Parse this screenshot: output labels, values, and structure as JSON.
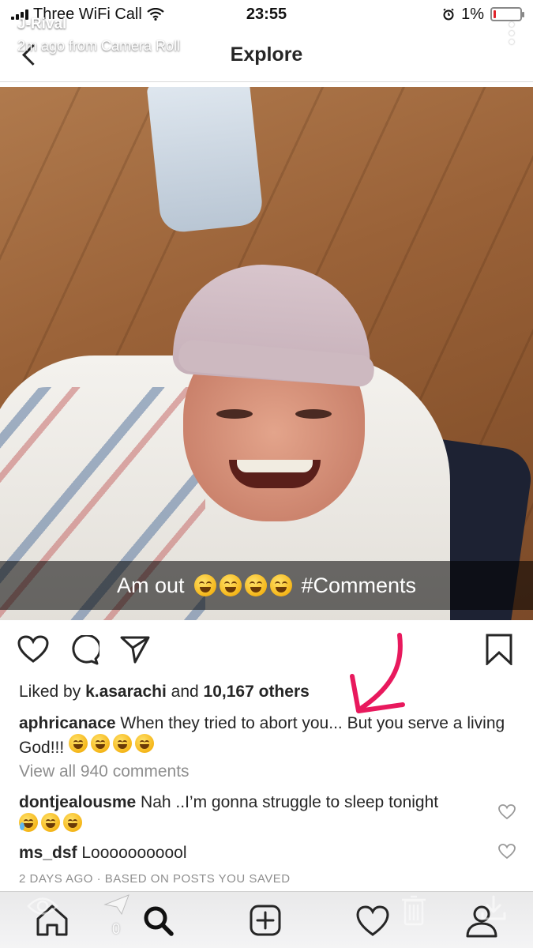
{
  "status_bar": {
    "carrier": "Three WiFi Call",
    "time": "23:55",
    "battery": "1%",
    "battery_level": 0.01,
    "battery_color": "#e0242b"
  },
  "snap_overlay": {
    "username": "J-Rival",
    "subtitle": "2m ago from Camera Roll"
  },
  "nav": {
    "title": "Explore"
  },
  "post": {
    "image_caption": "Am out",
    "image_hashtag": "#Comments",
    "likes_prefix": "Liked by",
    "liked_by_user": "k.asarachi",
    "likes_and": "and",
    "likes_others": "10,167 others",
    "caption_user": "aphricanace",
    "caption_text": "When they tried to abort you... But you serve a living God!!!",
    "view_all_comments": "View all 940 comments",
    "comments": [
      {
        "user": "dontjealousme",
        "text": "Nah ..I’m gonna struggle to sleep tonight"
      },
      {
        "user": "ms_dsf",
        "text": "Looooooooool"
      }
    ],
    "timestamp": "2 DAYS AGO · BASED ON POSTS YOU SAVED"
  },
  "tab_bar": {
    "overlay_count": "0"
  },
  "colors": {
    "annotation_arrow": "#e8195d",
    "text_primary": "#262626",
    "text_secondary": "#8e8e8e"
  },
  "icons": [
    "back-chevron-icon",
    "heart-icon",
    "comment-icon",
    "share-icon",
    "bookmark-icon",
    "home-icon",
    "search-icon",
    "add-icon",
    "activity-heart-icon",
    "profile-icon"
  ]
}
